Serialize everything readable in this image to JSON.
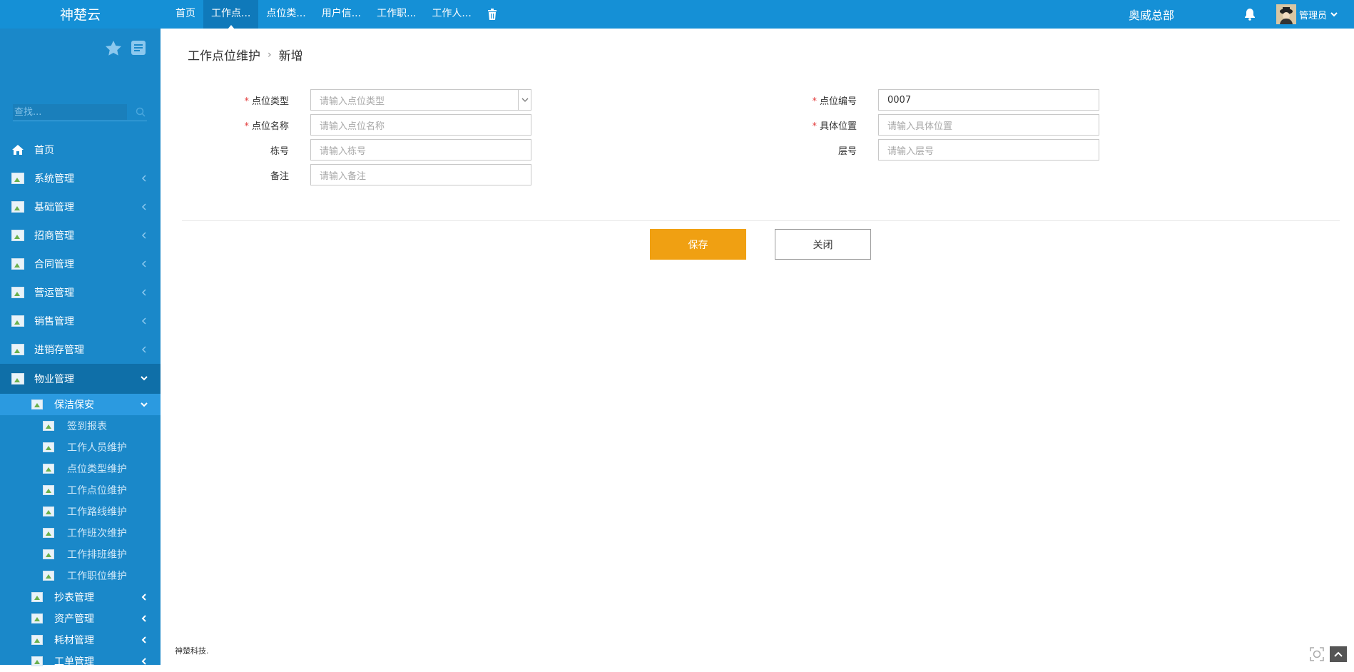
{
  "app": {
    "brand": "神楚云",
    "org": "奥威总部",
    "user": "管理员"
  },
  "tabs": [
    "首页",
    "工作点...",
    "点位类...",
    "用户信...",
    "工作职...",
    "工作人..."
  ],
  "sidebar": {
    "search_placeholder": "查找...",
    "items": [
      {
        "label": "首页"
      },
      {
        "label": "系统管理"
      },
      {
        "label": "基础管理"
      },
      {
        "label": "招商管理"
      },
      {
        "label": "合同管理"
      },
      {
        "label": "营运管理"
      },
      {
        "label": "销售管理"
      },
      {
        "label": "进销存管理"
      },
      {
        "label": "物业管理"
      }
    ],
    "sub": {
      "label": "保洁保安",
      "leaves": [
        "签到报表",
        "工作人员维护",
        "点位类型维护",
        "工作点位维护",
        "工作路线维护",
        "工作班次维护",
        "工作排班维护",
        "工作职位维护"
      ]
    },
    "sub_more": [
      "抄表管理",
      "资产管理",
      "耗材管理",
      "工单管理"
    ]
  },
  "breadcrumb": {
    "parent": "工作点位维护",
    "current": "新增"
  },
  "form": {
    "point_type": {
      "label": "点位类型",
      "placeholder": "请输入点位类型"
    },
    "point_code": {
      "label": "点位编号",
      "value": "0007"
    },
    "point_name": {
      "label": "点位名称",
      "placeholder": "请输入点位名称"
    },
    "location": {
      "label": "具体位置",
      "placeholder": "请输入具体位置"
    },
    "building": {
      "label": "栋号",
      "placeholder": "请输入栋号"
    },
    "floor": {
      "label": "层号",
      "placeholder": "请输入层号"
    },
    "remark": {
      "label": "备注",
      "placeholder": "请输入备注"
    },
    "required_mark": "*"
  },
  "buttons": {
    "save": "保存",
    "close": "关闭"
  },
  "footer": "神楚科技.",
  "colors": {
    "topbar": "#1590d6",
    "sidebar": "#1a88c9",
    "save": "#f0a012"
  }
}
